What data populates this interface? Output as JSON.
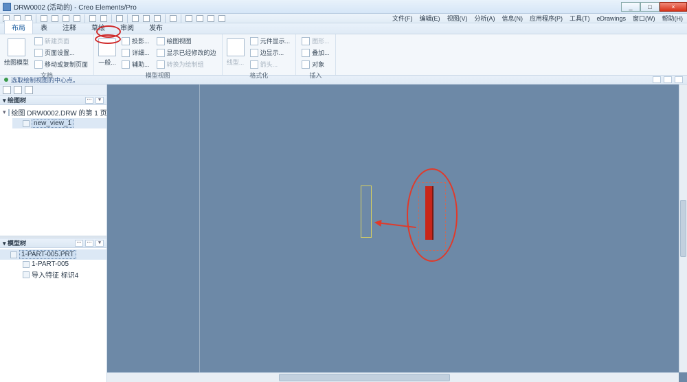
{
  "window": {
    "title": "DRW0002 (活动的) - Creo Elements/Pro"
  },
  "menus": {
    "file": "文件(F)",
    "edit": "编辑(E)",
    "view": "视图(V)",
    "analyze": "分析(A)",
    "info": "信息(N)",
    "apps": "应用程序(P)",
    "tools": "工具(T)",
    "edrawings": "eDrawings",
    "window": "窗口(W)",
    "help": "帮助(H)"
  },
  "ribbon_tabs": {
    "layout": "布局",
    "table": "表",
    "annotate": "注释",
    "sketch": "草绘",
    "review": "审阅",
    "publish": "发布"
  },
  "ribbon": {
    "g1": {
      "new_page": "新建页面",
      "page_setup": "页面设置...",
      "move_copy": "移动或复制页面",
      "big": "绘图模型",
      "label": "文档"
    },
    "g2": {
      "big": "一般...",
      "projection": "投影...",
      "detail": "详细...",
      "aux": "辅助...",
      "rev": "绘图视图",
      "showedges": "显示已经修改的边",
      "convert": "转换为绘制组",
      "label": "模型视图"
    },
    "g3": {
      "big": "线型...",
      "comp_disp": "元件显示...",
      "edge_disp": "边显示...",
      "arrow": "箭头...",
      "label": "格式化"
    },
    "g4": {
      "pic": "图形...",
      "overlay": "叠加...",
      "object": "对象",
      "label": "插入"
    }
  },
  "hint": "选取绘制视图的中心点。",
  "drawing_tree": {
    "title": "绘图树",
    "root": "绘图 DRW0002.DRW 的第 1 页",
    "view1": "new_view_1"
  },
  "model_tree": {
    "title": "模型树",
    "root": "1-PART-005.PRT",
    "n1": "1-PART-005",
    "n2": "导入特征 标识4"
  }
}
